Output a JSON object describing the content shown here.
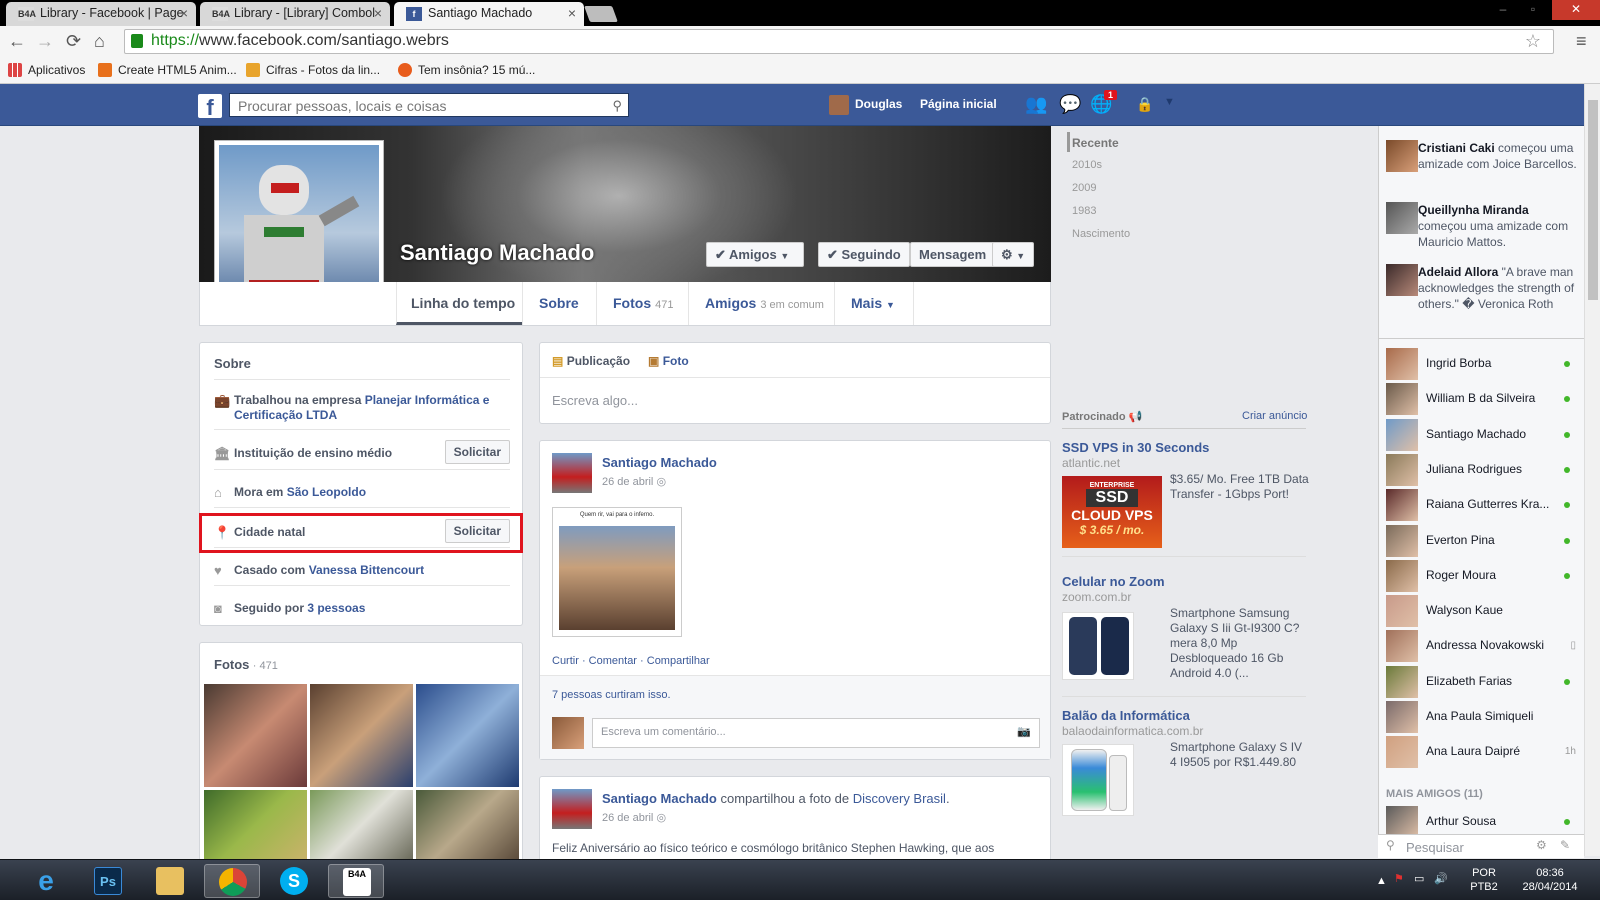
{
  "browser": {
    "tabs": [
      {
        "favicon": "B4A",
        "title": "Library - Facebook | Page"
      },
      {
        "favicon": "B4A",
        "title": "Library - [Library] Combol"
      },
      {
        "favicon": "f",
        "title": "Santiago Machado"
      }
    ],
    "url_scheme": "https://",
    "url_rest": "www.facebook.com/santiago.webrs",
    "bookmarks": [
      "Aplicativos",
      "Create HTML5 Anim...",
      "Cifras - Fotos da lin...",
      "Tem insônia? 15 mú..."
    ]
  },
  "fb_header": {
    "search_placeholder": "Procurar pessoas, locais e coisas",
    "user_name": "Douglas",
    "home_label": "Página inicial",
    "notification_count": "1"
  },
  "profile": {
    "name": "Santiago Machado",
    "buttons": {
      "friends": "✔ Amigos",
      "following": "✔ Seguindo",
      "message": "Mensagem",
      "settings": "⚙"
    },
    "tabs": [
      {
        "label": "Linha do tempo",
        "count": ""
      },
      {
        "label": "Sobre",
        "count": ""
      },
      {
        "label": "Fotos",
        "count": "471"
      },
      {
        "label": "Amigos",
        "count": "3 em comum"
      },
      {
        "label": "Mais",
        "count": ""
      }
    ]
  },
  "about": {
    "title": "Sobre",
    "work_prefix": "Trabalhou na empresa ",
    "work_company": "Planejar Informática e Certificação LTDA",
    "highschool": "Instituição de ensino médio",
    "request_label": "Solicitar",
    "lives_prefix": "Mora em ",
    "lives_city": "São Leopoldo",
    "hometown": "Cidade natal",
    "married_prefix": "Casado com ",
    "married_to": "Vanessa Bittencourt",
    "followed_prefix": "Seguido por ",
    "followed_count": "3 pessoas"
  },
  "photos": {
    "title": "Fotos",
    "count": "· 471"
  },
  "composer": {
    "tab_post": "Publicação",
    "tab_photo": "Foto",
    "placeholder": "Escreva algo..."
  },
  "posts": [
    {
      "author": "Santiago Machado",
      "date": "26 de abril",
      "image_caption": "Quem rir, vai para o inferno.",
      "actions": [
        "Curtir",
        "Comentar",
        "Compartilhar"
      ],
      "likes": "7 pessoas curtiram isso.",
      "comment_placeholder": "Escreva um comentário..."
    },
    {
      "author": "Santiago Machado",
      "shared_text": "compartilhou a foto de",
      "shared_from": "Discovery Brasil",
      "date": "26 de abril",
      "body": "Feliz Aniversário ao físico teórico e cosmólogo britânico Stephen Hawking, que aos"
    }
  ],
  "timeline_years": [
    "Recente",
    "2010s",
    "2009",
    "1983",
    "Nascimento"
  ],
  "sponsored": {
    "title": "Patrocinado",
    "create_ad": "Criar anúncio",
    "ads": [
      {
        "title": "SSD VPS in 30 Seconds",
        "url": "atlantic.net",
        "text": "$3.65/ Mo. Free 1TB Data Transfer - 1Gbps Port!",
        "img_lines": [
          "ENTERPRISE",
          "SSD",
          "CLOUD VPS",
          "$ 3.65 / mo."
        ]
      },
      {
        "title": "Celular no Zoom",
        "url": "zoom.com.br",
        "text": "Smartphone Samsung Galaxy S Iii Gt-I9300 C?mera 8,0 Mp Desbloqueado 16 Gb Android 4.0 (..."
      },
      {
        "title": "Balão da Informática",
        "url": "balaodainformatica.com.br",
        "text": "Smartphone Galaxy S IV 4 I9505 por R$1.449.80"
      }
    ]
  },
  "ticker": [
    {
      "name": "Cristiani Caki",
      "text": " começou uma amizade com Joice Barcellos."
    },
    {
      "name": "Queillynha Miranda",
      "text": " começou uma amizade com Mauricio Mattos."
    },
    {
      "name": "Adelaid Allora",
      "text": " \"A brave man acknowledges the strength of others.\" � Veronica Roth"
    }
  ],
  "chat": {
    "friends": [
      {
        "name": "Ingrid Borba",
        "status": "online"
      },
      {
        "name": "William B da Silveira",
        "status": "online"
      },
      {
        "name": "Santiago Machado",
        "status": "online"
      },
      {
        "name": "Juliana Rodrigues",
        "status": "online"
      },
      {
        "name": "Raiana Gutterres Kra...",
        "status": "online"
      },
      {
        "name": "Everton Pina",
        "status": "online"
      },
      {
        "name": "Roger Moura",
        "status": "online"
      },
      {
        "name": "Walyson Kaue",
        "status": ""
      },
      {
        "name": "Andressa Novakowski",
        "status": "mobile"
      },
      {
        "name": "Elizabeth Farias",
        "status": "online"
      },
      {
        "name": "Ana Paula Simiqueli",
        "status": ""
      },
      {
        "name": "Ana Laura Daipré",
        "status": "1h"
      }
    ],
    "more_header": "MAIS AMIGOS (11)",
    "more": [
      {
        "name": "Arthur Sousa",
        "status": "online"
      }
    ],
    "search_placeholder": "Pesquisar"
  },
  "taskbar": {
    "apps": [
      "ie-icon",
      "photoshop-icon",
      "explorer-icon",
      "chrome-icon",
      "skype-icon",
      "basic4android-icon"
    ],
    "lang": "POR",
    "layout": "PTB2",
    "time": "08:36",
    "date": "28/04/2014"
  }
}
